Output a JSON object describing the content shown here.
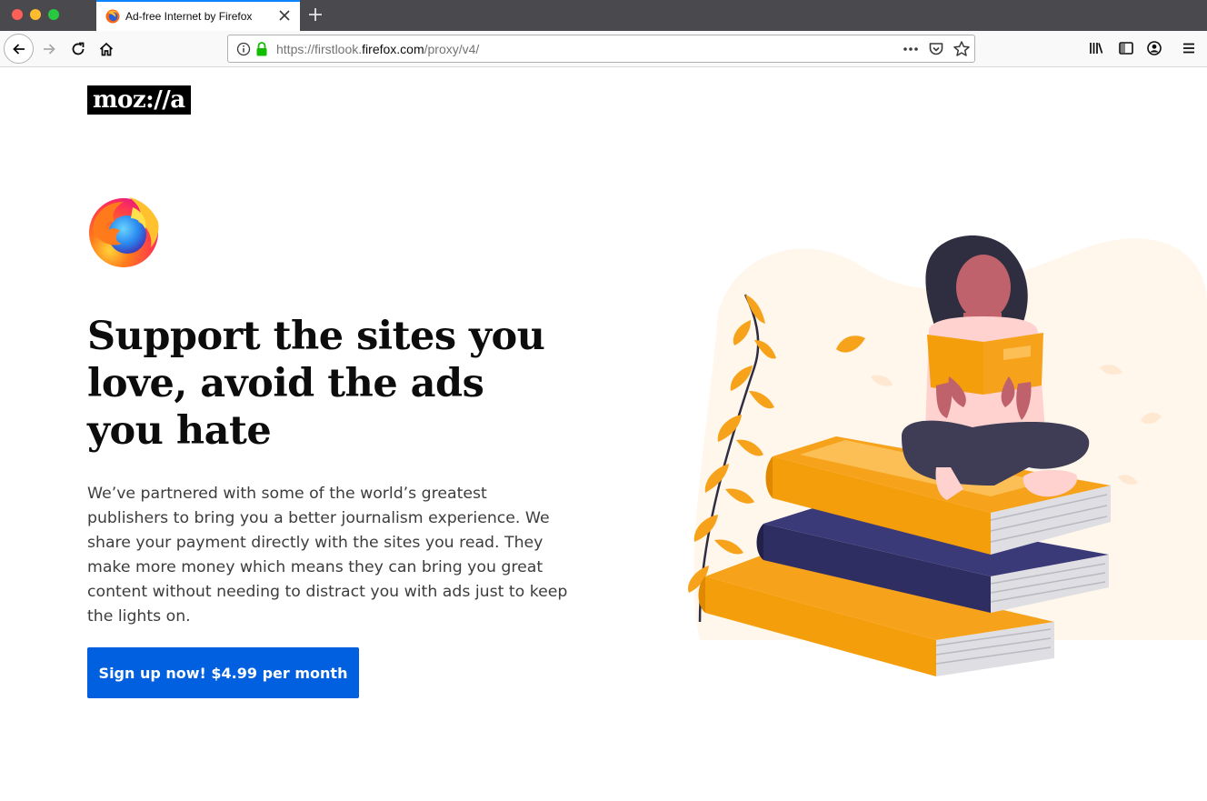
{
  "browser": {
    "tab_title": "Ad-free Internet by Firefox",
    "url_prefix": "https://firstlook.",
    "url_domain": "firefox.com",
    "url_path": "/proxy/v4/",
    "icons": [
      "back-icon",
      "forward-icon",
      "reload-icon",
      "home-icon",
      "info-icon",
      "lock-icon",
      "more-icon",
      "pocket-icon",
      "star-icon",
      "library-icon",
      "sidebar-icon",
      "account-icon",
      "menu-icon"
    ]
  },
  "page": {
    "brand": "moz://a",
    "headline": "Support the sites you love, avoid the ads you hate",
    "body": "We’ve partnered with some of the world’s greatest publishers to bring you a better journalism experience. We share your payment directly with the sites you read. They make more money which means they can bring you great content without needing to distract you with ads just to keep the lights on.",
    "cta_label": "Sign up now! $4.99 per month"
  },
  "colors": {
    "accent": "#0060df",
    "tab_highlight": "#0a84ff",
    "book_orange": "#f59e0b",
    "book_navy": "#2f2e62"
  }
}
